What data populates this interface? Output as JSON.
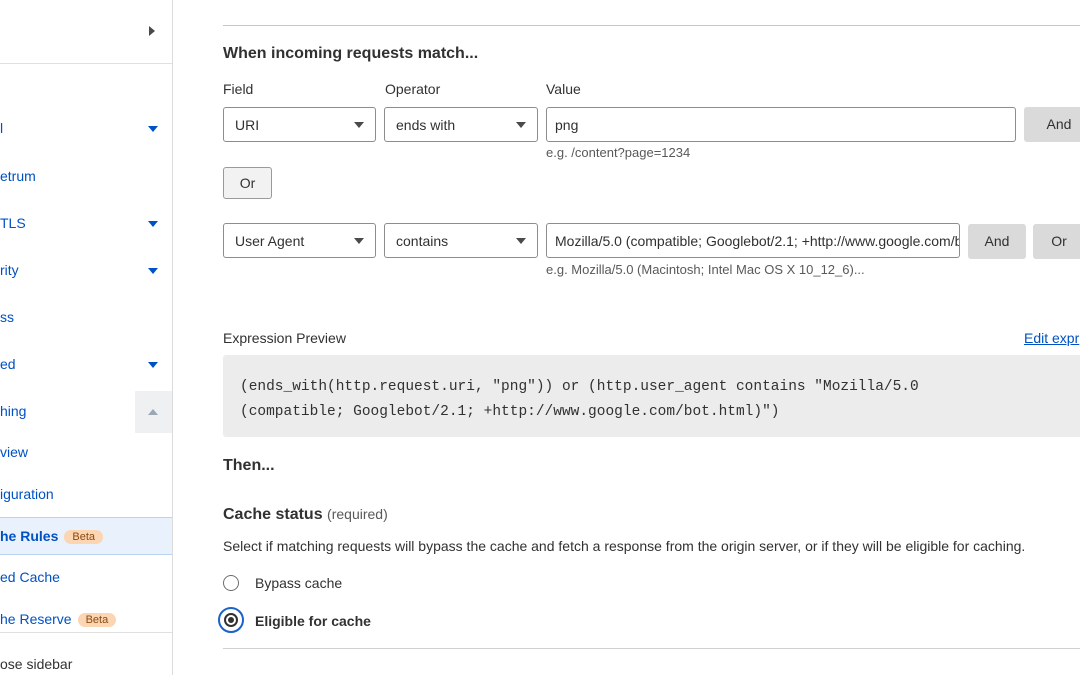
{
  "sidebar": {
    "items": [
      {
        "label": "l"
      },
      {
        "label": "etrum"
      },
      {
        "label": "TLS"
      },
      {
        "label": "rity"
      },
      {
        "label": "ss"
      },
      {
        "label": "ed"
      },
      {
        "label": "hing"
      },
      {
        "label": "view"
      },
      {
        "label": "iguration"
      },
      {
        "label": "he Rules",
        "badge": "Beta"
      },
      {
        "label": "ed Cache"
      },
      {
        "label": "he Reserve",
        "badge": "Beta"
      }
    ],
    "collapse_label": "ose sidebar"
  },
  "rule_builder": {
    "heading": "When incoming requests match...",
    "columns": {
      "field": "Field",
      "operator": "Operator",
      "value": "Value"
    },
    "row1": {
      "field": "URI",
      "operator": "ends with",
      "value": "png",
      "hint": "e.g. /content?page=1234",
      "and_label": "And"
    },
    "or_label": "Or",
    "row2": {
      "field": "User Agent",
      "operator": "contains",
      "value": "Mozilla/5.0 (compatible; Googlebot/2.1; +http://www.google.com/bot.html)",
      "hint": "e.g. Mozilla/5.0 (Macintosh; Intel Mac OS X 10_12_6)...",
      "and_label": "And",
      "or_label": "Or"
    }
  },
  "expression": {
    "label": "Expression Preview",
    "edit_link": "Edit expr",
    "line1": "(ends_with(http.request.uri, \"png\")) or (http.user_agent contains \"Mozilla/5.0",
    "line2": "(compatible; Googlebot/2.1; +http://www.google.com/bot.html)\")"
  },
  "then": {
    "heading": "Then...",
    "cache_status": {
      "title": "Cache status",
      "required": "(required)",
      "description": "Select if matching requests will bypass the cache and fetch a response from the origin server, or if they will be eligible for caching.",
      "options": [
        {
          "label": "Bypass cache",
          "selected": false
        },
        {
          "label": "Eligible for cache",
          "selected": true
        }
      ]
    }
  },
  "colors": {
    "link": "#0051c3",
    "badge_bg": "#fcd5b3",
    "active_bg": "#e8f1fc"
  }
}
